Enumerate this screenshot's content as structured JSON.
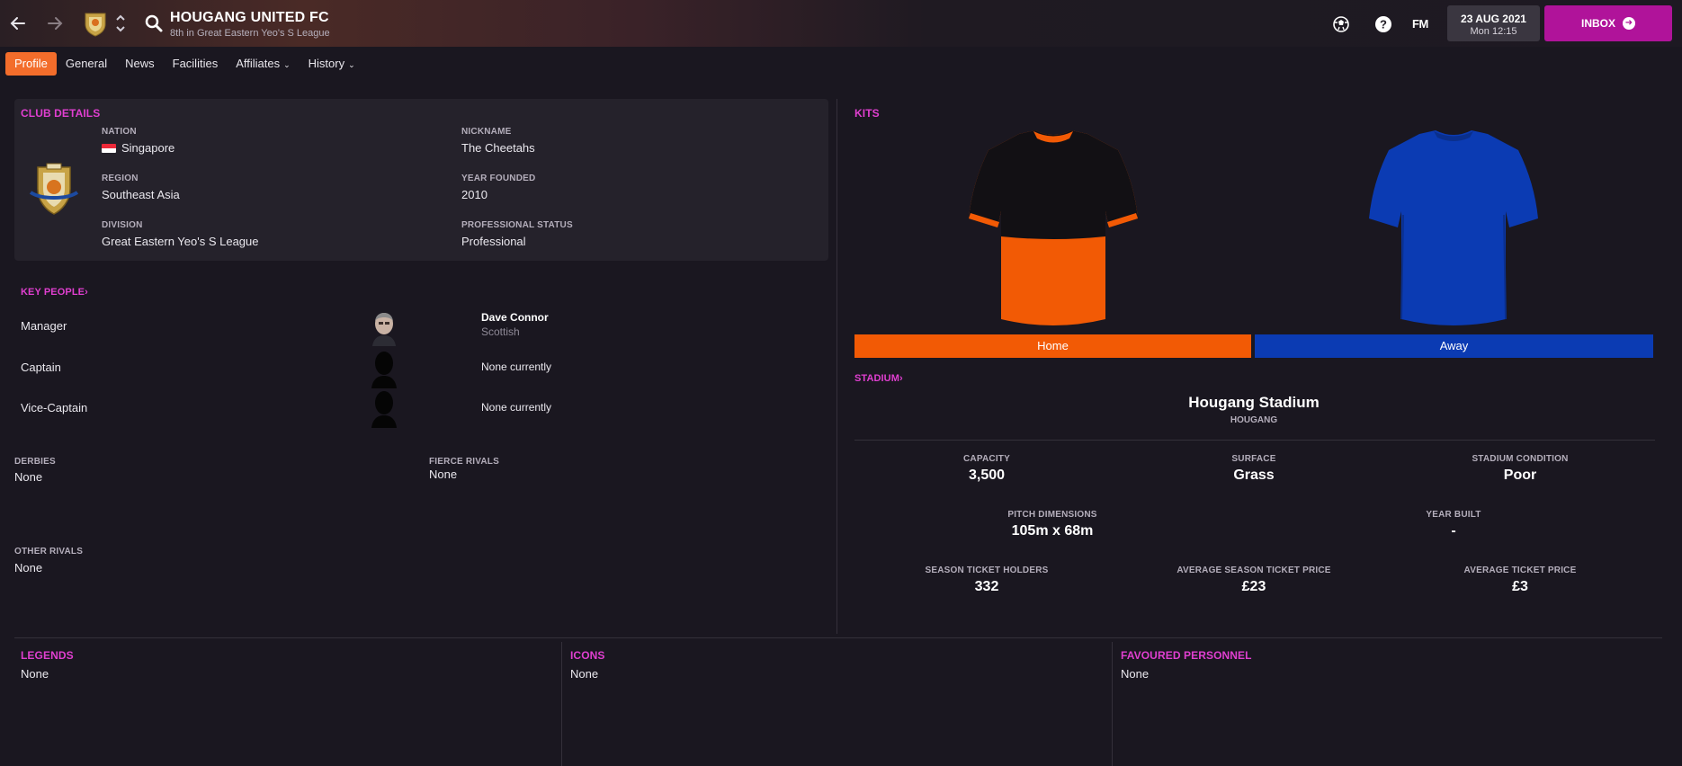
{
  "header": {
    "club_name": "HOUGANG UNITED FC",
    "club_subtitle": "8th in Great Eastern Yeo's S League",
    "fm_logo": "FM",
    "date": "23 AUG 2021",
    "time": "Mon 12:15",
    "inbox_label": "INBOX",
    "icons": [
      "back-arrow-icon",
      "forward-arrow-icon",
      "club-crest-icon",
      "chevron-updown-icon",
      "search-icon",
      "football-icon",
      "help-icon"
    ]
  },
  "tabs": [
    {
      "label": "Profile",
      "active": true
    },
    {
      "label": "General"
    },
    {
      "label": "News"
    },
    {
      "label": "Facilities"
    },
    {
      "label": "Affiliates",
      "dropdown": true
    },
    {
      "label": "History",
      "dropdown": true
    }
  ],
  "club_details": {
    "title": "CLUB DETAILS",
    "nation_label": "NATION",
    "nation": "Singapore",
    "region_label": "REGION",
    "region": "Southeast Asia",
    "division_label": "DIVISION",
    "division": "Great Eastern Yeo's S League",
    "nickname_label": "NICKNAME",
    "nickname": "The Cheetahs",
    "founded_label": "YEAR FOUNDED",
    "founded": "2010",
    "status_label": "PROFESSIONAL STATUS",
    "status": "Professional"
  },
  "key_people": {
    "title": "KEY PEOPLE",
    "rows": [
      {
        "role": "Manager",
        "name": "Dave Connor",
        "nationality": "Scottish"
      },
      {
        "role": "Captain",
        "name": "None currently"
      },
      {
        "role": "Vice-Captain",
        "name": "None currently"
      }
    ]
  },
  "rivals": {
    "derbies_label": "DERBIES",
    "derbies": "None",
    "fierce_label": "FIERCE RIVALS",
    "fierce": "None",
    "other_label": "OTHER RIVALS",
    "other": "None"
  },
  "kits": {
    "title": "KITS",
    "home_label": "Home",
    "home_color": "#f25a05",
    "away_label": "Away",
    "away_color": "#0b3bb3"
  },
  "stadium": {
    "title": "STADIUM",
    "name": "Hougang Stadium",
    "town": "HOUGANG",
    "capacity_label": "CAPACITY",
    "capacity": "3,500",
    "surface_label": "SURFACE",
    "surface": "Grass",
    "condition_label": "STADIUM CONDITION",
    "condition": "Poor",
    "pitch_label": "PITCH DIMENSIONS",
    "pitch": "105m x 68m",
    "built_label": "YEAR BUILT",
    "built": "-",
    "holders_label": "SEASON TICKET HOLDERS",
    "holders": "332",
    "avg_season_label": "AVERAGE SEASON TICKET PRICE",
    "avg_season": "£23",
    "avg_ticket_label": "AVERAGE TICKET PRICE",
    "avg_ticket": "£3"
  },
  "bottom": {
    "legends_title": "LEGENDS",
    "legends": "None",
    "icons_title": "ICONS",
    "icons": "None",
    "favoured_title": "FAVOURED PERSONNEL",
    "favoured": "None"
  },
  "colors": {
    "accent": "#e03fd0",
    "tab_active": "#f36d2b",
    "inbox": "#b0139a"
  }
}
